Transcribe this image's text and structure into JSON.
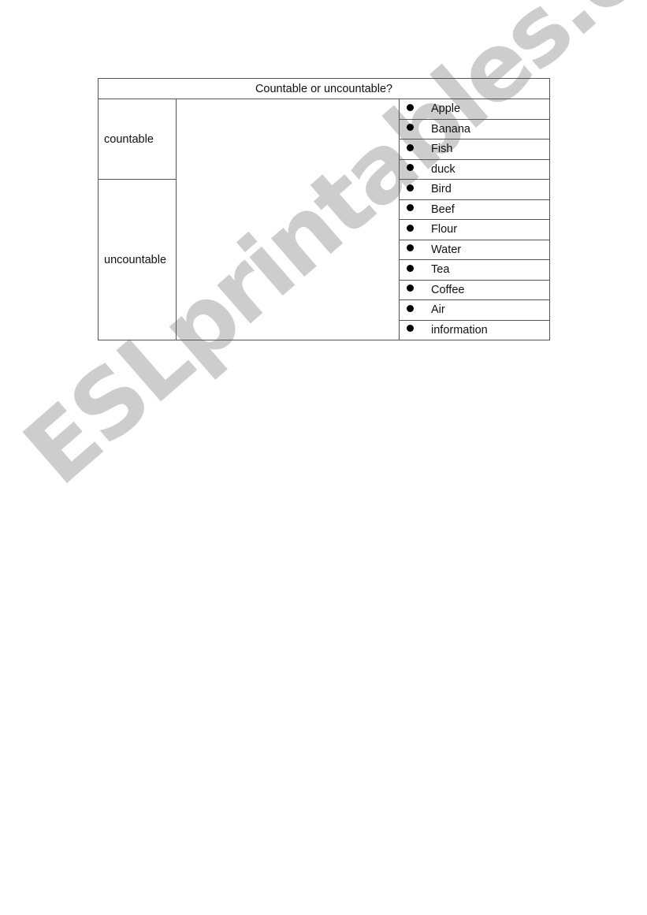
{
  "worksheet": {
    "title": "Countable or uncountable?",
    "categories": [
      {
        "label": "countable"
      },
      {
        "label": "uncountable"
      }
    ],
    "words": [
      {
        "label": "Apple"
      },
      {
        "label": "Banana"
      },
      {
        "label": "Fish"
      },
      {
        "label": "duck"
      },
      {
        "label": "Bird"
      },
      {
        "label": "Beef"
      },
      {
        "label": "Flour"
      },
      {
        "label": "Water"
      },
      {
        "label": "Tea"
      },
      {
        "label": "Coffee"
      },
      {
        "label": "Air"
      },
      {
        "label": "information"
      }
    ],
    "bullet_icon": "filled-circle"
  },
  "watermark": {
    "text": "ESLprintables.com",
    "color": "#c9c9c9"
  }
}
